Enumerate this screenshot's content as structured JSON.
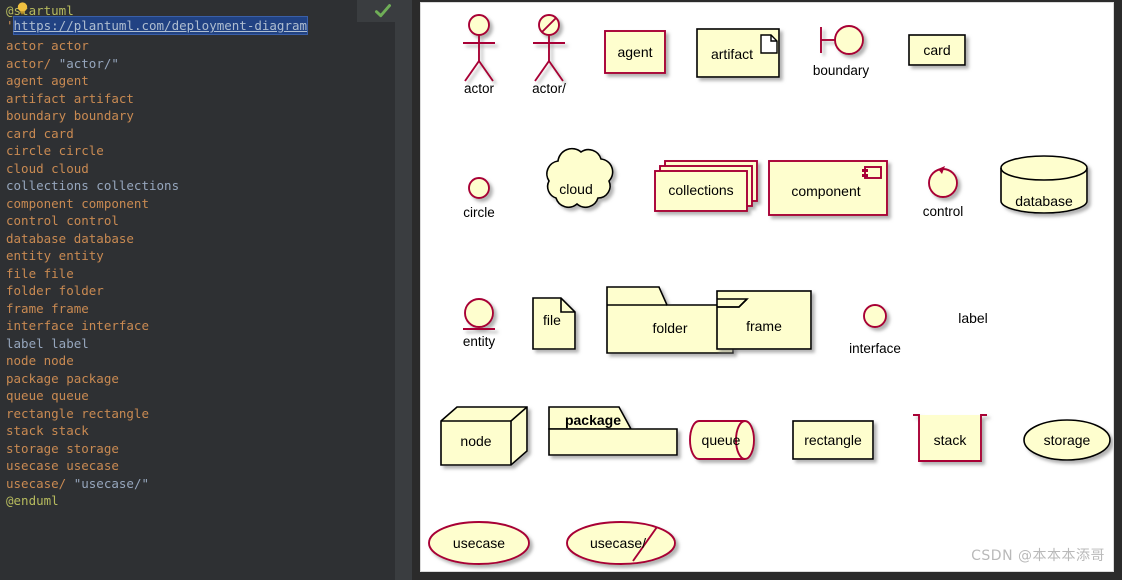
{
  "editor": {
    "name": "plantuml-code-editor",
    "status_icon": "green-check-icon",
    "hint_icon": "lightbulb-icon",
    "url_line_prefix": "'",
    "url_text": "https://plantuml.com/deployment-diagram",
    "lines": [
      {
        "text": "@startuml",
        "kind": "keyword"
      },
      {
        "text": "",
        "kind": "blank"
      },
      {
        "text": "actor actor",
        "kind": "ident"
      },
      {
        "text": "actor/ \"actor/\"",
        "kind": "ident-quoted",
        "a": "actor/",
        "b": "\"actor/\""
      },
      {
        "text": "agent agent",
        "kind": "ident"
      },
      {
        "text": "artifact artifact",
        "kind": "ident"
      },
      {
        "text": "boundary boundary",
        "kind": "ident"
      },
      {
        "text": "card card",
        "kind": "ident"
      },
      {
        "text": "circle circle",
        "kind": "ident"
      },
      {
        "text": "cloud cloud",
        "kind": "ident"
      },
      {
        "text": "collections collections",
        "kind": "alt"
      },
      {
        "text": "component component",
        "kind": "ident"
      },
      {
        "text": "control control",
        "kind": "ident"
      },
      {
        "text": "database database",
        "kind": "ident"
      },
      {
        "text": "entity entity",
        "kind": "ident"
      },
      {
        "text": "file file",
        "kind": "ident"
      },
      {
        "text": "folder folder",
        "kind": "ident"
      },
      {
        "text": "frame frame",
        "kind": "ident"
      },
      {
        "text": "interface interface",
        "kind": "ident"
      },
      {
        "text": "label label",
        "kind": "alt"
      },
      {
        "text": "node node",
        "kind": "ident"
      },
      {
        "text": "package package",
        "kind": "ident"
      },
      {
        "text": "queue queue",
        "kind": "ident"
      },
      {
        "text": "rectangle rectangle",
        "kind": "ident"
      },
      {
        "text": "stack stack",
        "kind": "ident"
      },
      {
        "text": "storage storage",
        "kind": "ident"
      },
      {
        "text": "usecase usecase",
        "kind": "ident"
      },
      {
        "text": "usecase/ \"usecase/\"",
        "kind": "ident-quoted",
        "a": "usecase/",
        "b": "\"usecase/\""
      },
      {
        "text": "@enduml",
        "kind": "keyword"
      }
    ]
  },
  "diagram": {
    "name": "plantuml-deployment-diagram-preview",
    "row1": [
      {
        "id": "actor",
        "label": "actor"
      },
      {
        "id": "actor-alt",
        "label": "actor/"
      },
      {
        "id": "agent",
        "label": "agent"
      },
      {
        "id": "artifact",
        "label": "artifact"
      },
      {
        "id": "boundary",
        "label": "boundary"
      },
      {
        "id": "card",
        "label": "card"
      }
    ],
    "row2": [
      {
        "id": "circle",
        "label": "circle"
      },
      {
        "id": "cloud",
        "label": "cloud"
      },
      {
        "id": "collections",
        "label": "collections"
      },
      {
        "id": "component",
        "label": "component"
      },
      {
        "id": "control",
        "label": "control"
      },
      {
        "id": "database",
        "label": "database"
      }
    ],
    "row3": [
      {
        "id": "entity",
        "label": "entity"
      },
      {
        "id": "file",
        "label": "file"
      },
      {
        "id": "folder",
        "label": "folder"
      },
      {
        "id": "frame",
        "label": "frame"
      },
      {
        "id": "interface",
        "label": "interface"
      },
      {
        "id": "label",
        "label": "label"
      }
    ],
    "row4": [
      {
        "id": "node",
        "label": "node"
      },
      {
        "id": "package",
        "label": "package"
      },
      {
        "id": "queue",
        "label": "queue"
      },
      {
        "id": "rectangle",
        "label": "rectangle"
      },
      {
        "id": "stack",
        "label": "stack"
      },
      {
        "id": "storage",
        "label": "storage"
      }
    ],
    "row5": [
      {
        "id": "usecase",
        "label": "usecase"
      },
      {
        "id": "usecase-alt",
        "label": "usecase/"
      }
    ]
  },
  "colors": {
    "shape_fill": "#FEFECE",
    "shape_stroke_dark": "#000000",
    "shape_stroke_accent": "#A80036",
    "editor_bg": "#2e3033",
    "keyword": "#b6ba5e",
    "ident": "#c98a52",
    "alt_ident": "#96a6bd",
    "selection": "#214283",
    "check": "#6a9e54"
  },
  "watermark": {
    "text": "CSDN @本本本添哥"
  }
}
